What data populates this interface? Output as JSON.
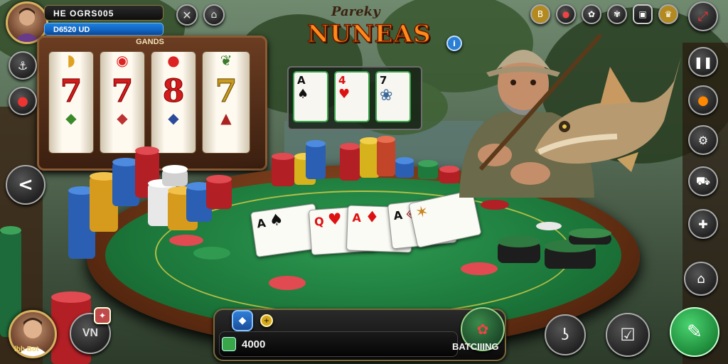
{
  "player": {
    "name": "HE OGRS005",
    "balance": "D6520 UD",
    "bottom_avatar_caption": "lbh Bot"
  },
  "slot_machine": {
    "label": "GANDS",
    "reels": [
      "7",
      "7",
      "8",
      "7"
    ]
  },
  "logo": {
    "top_text": "Pareky",
    "main_text": "NUNEAS"
  },
  "card_panel": {
    "cards": [
      "A",
      "4",
      "7"
    ]
  },
  "table": {
    "cards": [
      "A",
      "Q",
      "A",
      "A"
    ]
  },
  "bottom_bar": {
    "coins": "4000",
    "action_label": "BATCIIING",
    "left_button_label": "VN"
  },
  "top_icons": [
    "wrench-icon",
    "fish-icon",
    "gold-icon",
    "grenade-icon",
    "badge-icon",
    "frame-icon",
    "trophy-icon",
    "paint-icon"
  ],
  "left_icons": [
    "anchor-icon",
    "bird-icon",
    "back-arrow-icon"
  ],
  "right_icons": [
    "pause-icon",
    "bird-orange-icon",
    "robot-icon",
    "cart-icon",
    "puzzle-icon",
    "chest-icon"
  ],
  "bottom_icons": [
    "hook-icon",
    "checkbox-icon",
    "pen-icon"
  ],
  "colors": {
    "felt": "#1d7a3c",
    "rim": "#5a2a10",
    "logo": "#ff8a1a",
    "xp": "#1c7fe0",
    "accent": "#d6b25e"
  }
}
